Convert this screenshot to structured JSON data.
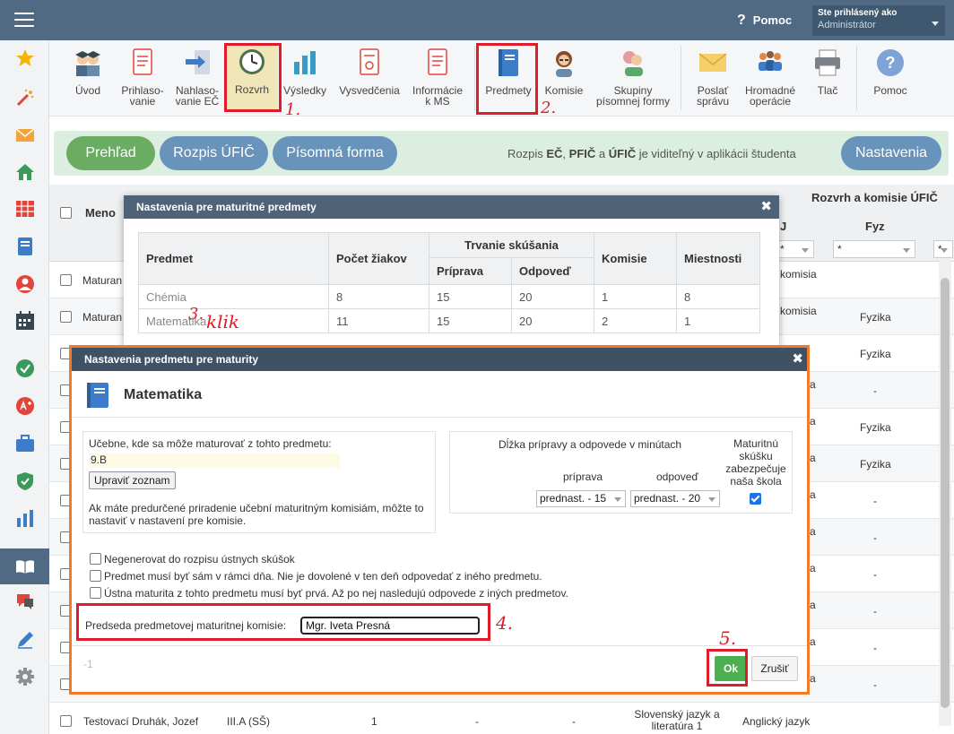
{
  "topbar": {
    "help_label": "Pomoc",
    "help_glyph": "?",
    "login_line1": "Ste prihlásený ako",
    "login_line2": "Administrátor"
  },
  "sidebar": {
    "icons": [
      "star-icon",
      "magic-wand-icon",
      "envelope-icon",
      "home-icon",
      "grid-calendar-icon",
      "id-card-icon",
      "person-icon",
      "calendar-icon",
      "check-circle-icon",
      "plus-circle-icon",
      "briefcase-icon",
      "shield-check-icon",
      "bar-chart-icon",
      "open-book-icon",
      "chat-icon",
      "pencil-icon",
      "gear-icon"
    ]
  },
  "toolbar": {
    "uvod": "Úvod",
    "prihlasovanie_1": "Prihlaso-",
    "prihlasovanie_2": "vanie",
    "nahlasovanie_1": "Nahlaso-",
    "nahlasovanie_2": "vanie EČ",
    "rozvrh": "Rozvrh",
    "vysledky": "Výsledky",
    "vysvedcenia": "Vysvedčenia",
    "informacie_1": "Informácie",
    "informacie_2": "k MS",
    "predmety": "Predmety",
    "komisie": "Komisie",
    "skupiny_1": "Skupiny",
    "skupiny_2": "písomnej formy",
    "poslat_1": "Poslať",
    "poslat_2": "správu",
    "hromadne_1": "Hromadné",
    "hromadne_2": "operácie",
    "tlac": "Tlač",
    "pomoc": "Pomoc"
  },
  "annotations": {
    "a1": "1.",
    "a2": "2.",
    "a3_num": "3.",
    "a3_word": "klik",
    "a4": "4.",
    "a5": "5."
  },
  "tabs": {
    "prehlad": "Prehľad",
    "rozpis_ufic": "Rozpis ÚFIČ",
    "pisomna": "Písomná forma",
    "nastavenia": "Nastavenia"
  },
  "band_note": {
    "pre": "Rozpis ",
    "bold1": "EČ",
    "mid1": ", ",
    "bold2": "PFIČ",
    "mid2": " a ",
    "bold3": "ÚFIČ",
    "post": " je viditeľný v aplikácii študenta"
  },
  "bg_table": {
    "header_meno": "Meno",
    "header_right": "Rozvrh a komisie ÚFIČ",
    "col_j": "J",
    "col_fyz": "Fyz",
    "filter_star": "*",
    "rows": [
      {
        "name": "Maturan",
        "col_j": "komisia",
        "fyz": ""
      },
      {
        "name": "Maturan",
        "col_j": "komisia",
        "fyz": "Fyzika"
      },
      {
        "name": "",
        "col_j": "",
        "fyz": "Fyzika"
      },
      {
        "name": "",
        "col_j": "a",
        "fyz": "-"
      },
      {
        "name": "",
        "col_j": "a",
        "fyz": "Fyzika"
      },
      {
        "name": "",
        "col_j": "a",
        "fyz": "Fyzika"
      },
      {
        "name": "",
        "col_j": "a",
        "fyz": "-"
      },
      {
        "name": "",
        "col_j": "a",
        "fyz": "-"
      },
      {
        "name": "",
        "col_j": "a",
        "fyz": "-"
      },
      {
        "name": "",
        "col_j": "a",
        "fyz": "-"
      },
      {
        "name": "",
        "col_j": "a",
        "fyz": "-"
      },
      {
        "name": "",
        "col_j": "a",
        "fyz": "-"
      }
    ],
    "last_row": {
      "name": "Testovací Druhák, Jozef",
      "class": "III.A (SŠ)",
      "num": "1",
      "d1": "-",
      "d2": "-",
      "subj1": "Slovenský jazyk a",
      "subj2": "literatúra 1",
      "subj3": "Anglický jazyk"
    }
  },
  "dialog1": {
    "title": "Nastavenia pre maturitné predmety",
    "close": "✖",
    "headers": {
      "predmet": "Predmet",
      "pocet": "Počet žiakov",
      "trvanie": "Trvanie skúšania",
      "priprava": "Príprava",
      "odpoved": "Odpoveď",
      "komisie": "Komisie",
      "miestnosti": "Miestnosti"
    },
    "rows": [
      {
        "predmet": "Chémia",
        "pocet": "8",
        "priprava": "15",
        "odpoved": "20",
        "komisie": "1",
        "miestnosti": "8"
      },
      {
        "predmet": "Matematika",
        "pocet": "11",
        "priprava": "15",
        "odpoved": "20",
        "komisie": "2",
        "miestnosti": "1"
      }
    ]
  },
  "dialog2": {
    "title": "Nastavenia predmetu pre maturity",
    "close": "✖",
    "subject": "Matematika",
    "ucebne_label": "Učebne, kde sa môže maturovať z tohto predmetu:",
    "ucebne_value": "9.B",
    "upravit_btn": "Upraviť zoznam",
    "note_1": "Ak máte predurčené priradenie učební maturitným komisiám, môžte to",
    "note_2": "nastaviť v nastavení pre komisie.",
    "dlzka_label": "Dĺžka prípravy a odpovede v minútach",
    "priprava_label": "príprava",
    "odpoved_label": "odpoveď",
    "priprava_value": "prednast. - 15",
    "odpoved_value": "prednast. - 20",
    "zabezpecuje_1": "Maturitnú",
    "zabezpecuje_2": "skúšku",
    "zabezpecuje_3": "zabezpečuje",
    "zabezpecuje_4": "naša škola",
    "zabezpecuje_checked": true,
    "check_1": "Negenerovat do rozpisu ústnych skúšok",
    "check_2": "Predmet musí byť sám v rámci dňa. Nie je dovolené v ten deň odpovedať z iného predmetu.",
    "check_3": "Ústna maturita z tohto predmetu musí byť prvá. Až po nej nasledujú odpovede z iných predmetov.",
    "predseda_label": "Predseda predmetovej maturitnej komisie:",
    "predseda_value": "Mgr. Iveta Presná",
    "footer_id": "-1",
    "ok": "Ok",
    "cancel": "Zrušiť"
  },
  "colors": {
    "topbar": "#506a83",
    "accent_red": "#e11c2a",
    "dialog_border": "#f27b2b",
    "ok_green": "#4caf50",
    "pill_green": "#6aad62",
    "pill_blue": "#6894bb"
  }
}
